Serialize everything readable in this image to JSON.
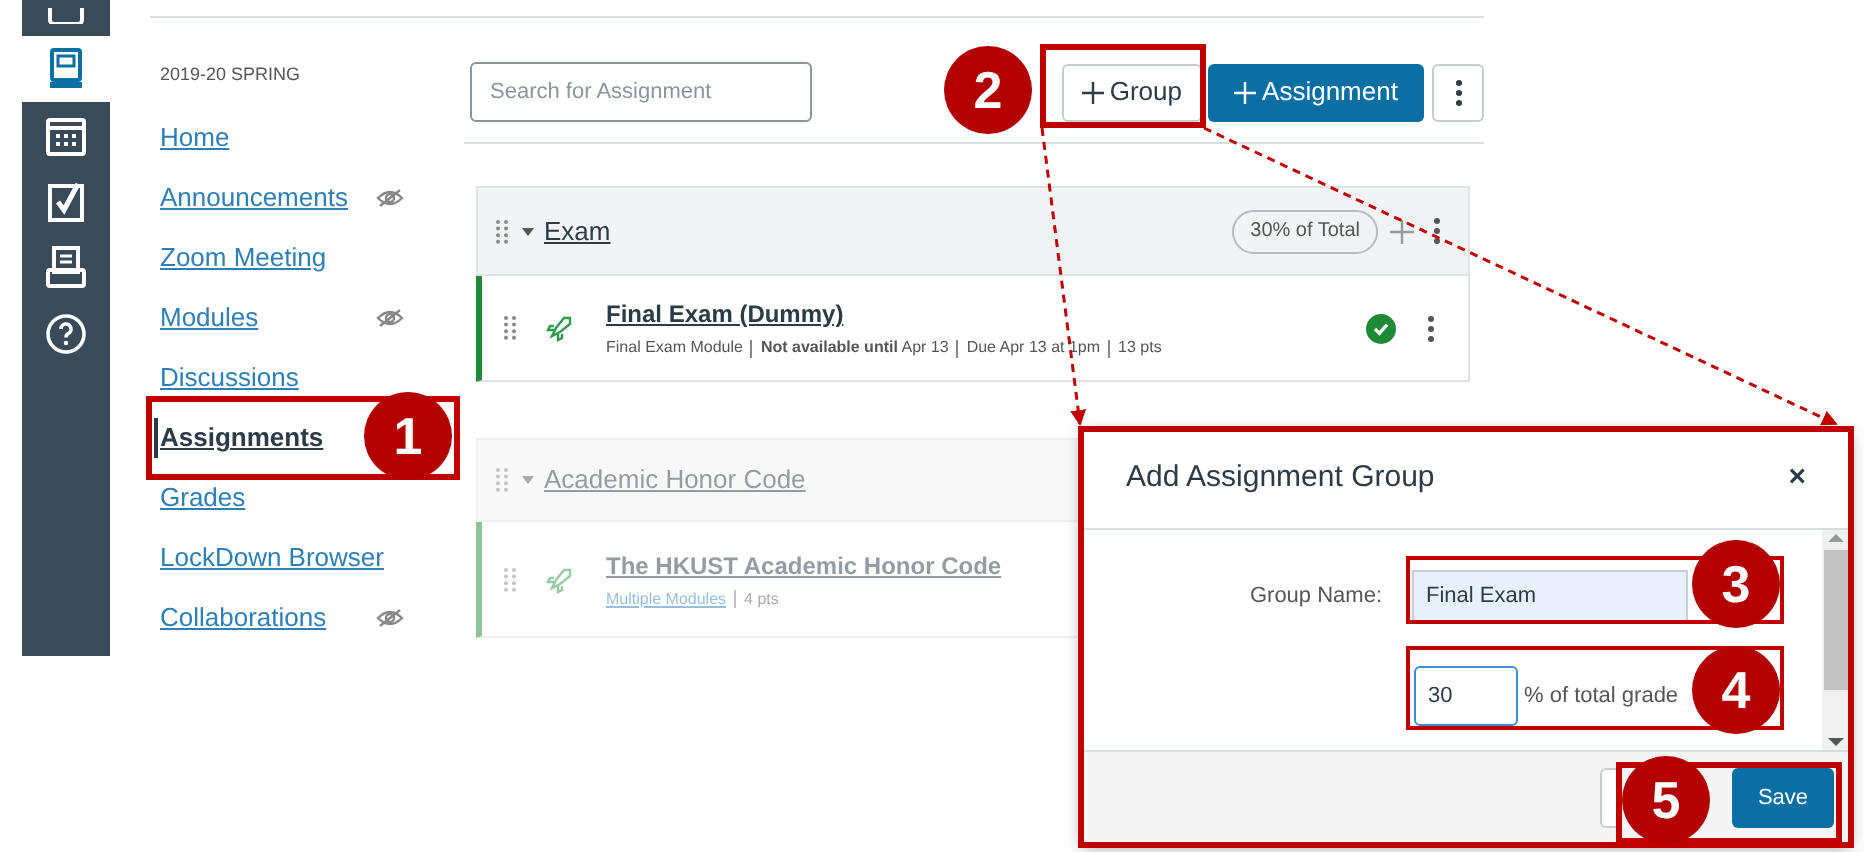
{
  "global_nav": [
    {
      "kind": "account",
      "selected": false
    },
    {
      "kind": "courses",
      "selected": true
    },
    {
      "kind": "calendar",
      "selected": false
    },
    {
      "kind": "todo",
      "selected": false
    },
    {
      "kind": "inbox",
      "selected": false
    },
    {
      "kind": "help",
      "selected": false
    }
  ],
  "course_nav": {
    "term": "2019-20 SPRING",
    "items": [
      {
        "label": "Home",
        "selected": false,
        "hidden": false
      },
      {
        "label": "Announcements",
        "selected": false,
        "hidden": true
      },
      {
        "label": "Zoom Meeting",
        "selected": false,
        "hidden": false
      },
      {
        "label": "Modules",
        "selected": false,
        "hidden": true
      },
      {
        "label": "Discussions",
        "selected": false,
        "hidden": false
      },
      {
        "label": "Assignments",
        "selected": true,
        "hidden": false
      },
      {
        "label": "Grades",
        "selected": false,
        "hidden": false
      },
      {
        "label": "LockDown Browser",
        "selected": false,
        "hidden": false
      },
      {
        "label": "Collaborations",
        "selected": false,
        "hidden": true
      }
    ]
  },
  "toolbar": {
    "search_placeholder": "Search for Assignment",
    "group_button": "Group",
    "assignment_button": "Assignment"
  },
  "groups": [
    {
      "name": "Exam",
      "weight": "30% of Total",
      "faded": false,
      "assignments": [
        {
          "title": "Final Exam (Dummy)",
          "published": true,
          "details": [
            {
              "kind": "text",
              "text": "Final Exam Module"
            },
            {
              "kind": "text",
              "text": "**Not available until** Apr 13"
            },
            {
              "kind": "text",
              "text": "Due Apr 13 at 1pm"
            },
            {
              "kind": "text",
              "text": "13 pts"
            }
          ]
        }
      ]
    },
    {
      "name": "Academic Honor Code",
      "faded": true,
      "assignments": [
        {
          "title": "The HKUST Academic Honor Code",
          "details": [
            {
              "kind": "link",
              "text": "Multiple Modules"
            },
            {
              "kind": "text",
              "text": "4 pts"
            }
          ]
        }
      ]
    }
  ],
  "dialog": {
    "title": "Add Assignment Group",
    "close": "×",
    "group_name_label": "Group Name:",
    "group_name_value": "Final Exam",
    "weight_value": "30",
    "weight_suffix": "% of total grade",
    "save_button": "Save"
  },
  "callouts": [
    "1",
    "2",
    "3",
    "4",
    "5"
  ]
}
